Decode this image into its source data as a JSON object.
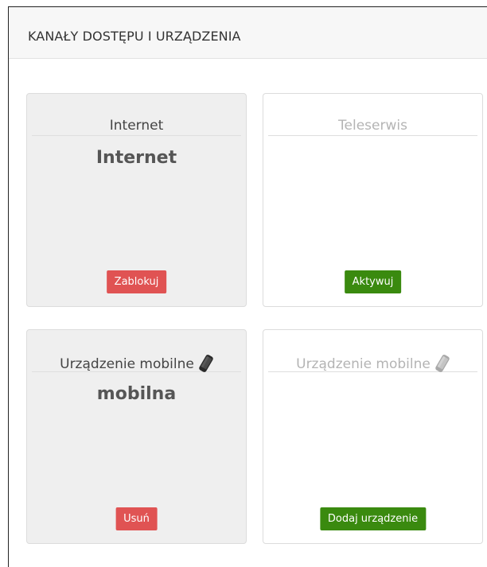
{
  "panel": {
    "title": "KANAŁY DOSTĘPU I URZĄDZENIA"
  },
  "cards": [
    {
      "header": "Internet",
      "value": "Internet",
      "button": "Zablokuj",
      "state": "active",
      "button_color": "#e05353"
    },
    {
      "header": "Teleserwis",
      "value": "",
      "button": "Aktywuj",
      "state": "inactive",
      "button_color": "#3a8a0f"
    },
    {
      "header": "Urządzenie mobilne",
      "value": "mobilna",
      "button": "Usuń",
      "state": "active",
      "icon": "mobile-phone-icon",
      "button_color": "#e05353"
    },
    {
      "header": "Urządzenie mobilne",
      "value": "",
      "button": "Dodaj urządzenie",
      "state": "inactive",
      "icon": "mobile-phone-icon",
      "button_color": "#3a8a0f"
    }
  ]
}
